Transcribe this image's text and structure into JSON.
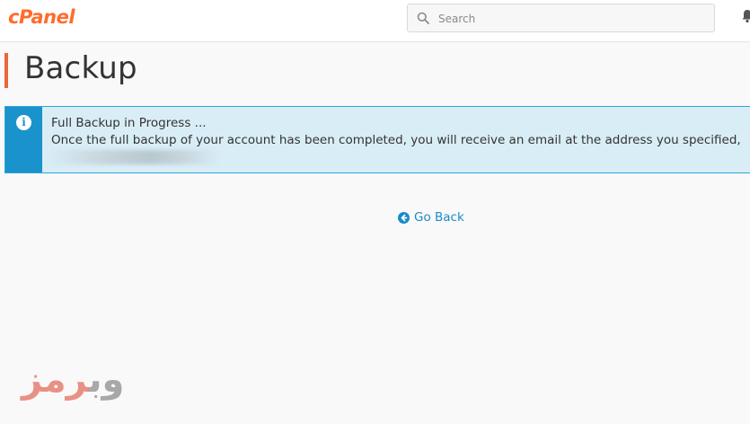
{
  "header": {
    "logo_text": "cPanel",
    "search": {
      "placeholder": "Search",
      "value": ""
    }
  },
  "page": {
    "title": "Backup"
  },
  "alert": {
    "title": "Full Backup in Progress ...",
    "message": "Once the full backup of your account has been completed, you will receive an email at the address you specified,"
  },
  "actions": {
    "go_back_label": "Go Back"
  },
  "watermark": {
    "part1": "وب",
    "part2": "رمز"
  },
  "colors": {
    "brand": "#ff6c2c",
    "title_accent": "#e8663a",
    "info": "#1a93cc",
    "alert_bg": "#d9edf7",
    "link": "#1a8bc6"
  }
}
